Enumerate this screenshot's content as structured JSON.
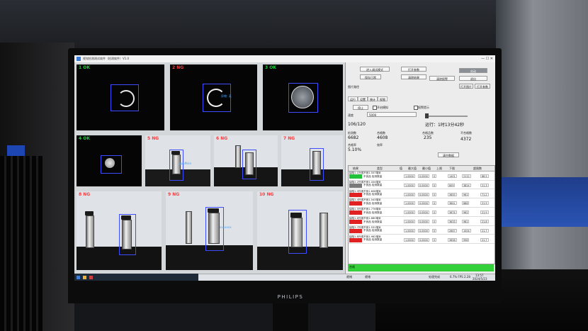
{
  "monitor": {
    "brand": "PHILIPS"
  },
  "window": {
    "title": "视觉检测测试软件（检测软件）V1.0",
    "controls": "— ☐ ✕"
  },
  "cameras": [
    {
      "label": "1 OK",
      "status": "ok"
    },
    {
      "label": "2 NG",
      "status": "ng"
    },
    {
      "label": "3 OK",
      "status": "ok"
    },
    {
      "label": "4 OK",
      "status": "ok"
    },
    {
      "label": "5 NG",
      "status": "ng"
    },
    {
      "label": "6 NG",
      "status": "ng"
    },
    {
      "label": "7 NG",
      "status": "ng"
    },
    {
      "label": "8 NG",
      "status": "ng"
    },
    {
      "label": "9 NG",
      "status": "ng"
    },
    {
      "label": "10 NG",
      "status": "ng"
    }
  ],
  "tags": {
    "cam2": "异物: 无",
    "cam5": "gpuMain",
    "cam9": "xxxxxxx"
  },
  "panel": {
    "buttons": [
      "进入调试模式",
      "打开参数",
      "启动",
      "保存日常",
      "清除结果",
      "清除报警",
      "退出"
    ],
    "path_label": "图片路径",
    "right_buttons": [
      "打开图片",
      "打开参数"
    ],
    "tabs": [
      "运行",
      "设置",
      "统计",
      "权限"
    ],
    "mode_button": "停止",
    "check1": "开启模拟",
    "check2": "报警提示",
    "speed_label": "速度",
    "speed_value": "5000",
    "counter": "106/120",
    "runtime": "运行：1时13分42秒",
    "stats_headers": [
      "检测数",
      "合格数",
      "合格品数",
      "不合格数"
    ],
    "stats_values": [
      "6682",
      "4608",
      "235",
      "4372"
    ],
    "rate_label": "合格率",
    "rate_value": "5.10%",
    "yield_label": "效率",
    "clear_label": "清空数据"
  },
  "table": {
    "headers": [
      "结果",
      "类型",
      "值",
      "最大值",
      "最小值",
      "上限",
      "下限",
      "超限数"
    ],
    "rows": [
      {
        "name": "缺陷1.1外观不良1.557毫米",
        "sub": "不良品 检测数量",
        "color": "#22c33a",
        "vals": [
          "1.0000",
          "0.0000",
          "0",
          "1401",
          "2112",
          "88.5"
        ]
      },
      {
        "name": "缺陷1.2外观不良1.434毫米",
        "sub": "不良品 检测数量",
        "color": "#7a7a7a",
        "vals": [
          "1.0000",
          "0.0000",
          "0",
          "809",
          "3824",
          "21.3"
        ]
      },
      {
        "name": "缺陷1.3外观不良1.658毫米",
        "sub": "不良品 检测数量",
        "color": "#e22222",
        "vals": [
          "1.0000",
          "0.0000",
          "0",
          "3655",
          "961",
          "71.2"
        ]
      },
      {
        "name": "缺陷1.4外观不良1.543毫米",
        "sub": "不良品 检测数量",
        "color": "#e22222",
        "vals": [
          "1.0000",
          "0.0000",
          "0",
          "3641",
          "886",
          "21.9"
        ]
      },
      {
        "name": "缺陷1.5外观不良1.776毫米",
        "sub": "不良品 检测数量",
        "color": "#e22222",
        "vals": [
          "1.0000",
          "0.0000",
          "0",
          "3674",
          "962",
          "21.9"
        ]
      },
      {
        "name": "缺陷1.6外观不良1.680毫米",
        "sub": "不良品 检测数量",
        "color": "#e22222",
        "vals": [
          "1.0000",
          "0.0000",
          "0",
          "3633",
          "981",
          "21.8"
        ]
      },
      {
        "name": "缺陷1.7外观不良1.531毫米",
        "sub": "不良品 检测数量",
        "color": "#e22222",
        "vals": [
          "1.0000",
          "0.0000",
          "0",
          "2647",
          "1004",
          "21.7"
        ]
      },
      {
        "name": "缺陷1.8外观不良1.962毫米",
        "sub": "不良品 检测数量",
        "color": "#e22222",
        "vals": [
          "1.0000",
          "0.0000",
          "0",
          "3658",
          "998",
          "21.7"
        ]
      }
    ]
  },
  "result_label": "合格",
  "statusbar": {
    "left": "就绪",
    "mid": "就绪",
    "status": "处理完成",
    "right": "6.7%  FPS 2.28",
    "time": "13:57",
    "date": "2024/5/23"
  },
  "colors": {
    "ok": "#19d13a",
    "ng": "#ff3b3b",
    "roi": "#3d4cff",
    "pass": "#35d13a"
  }
}
